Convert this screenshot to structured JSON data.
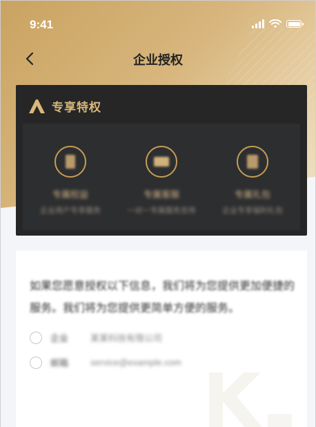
{
  "status_bar": {
    "time": "9:41"
  },
  "nav": {
    "title": "企业授权"
  },
  "privileges": {
    "title": "专享特权",
    "items": [
      {
        "label": "专属权益",
        "sub": "企业用户专享服务"
      },
      {
        "label": "专属客服",
        "sub": "一对一专属服务支持"
      },
      {
        "label": "专属礼包",
        "sub": "企业专享福利礼包"
      }
    ]
  },
  "authorization": {
    "intro": "如果您愿意授权以下信息，我们将为您提供更加便捷的服务。我们将为您提供更简单方便的服务。",
    "options": [
      {
        "label": "企业",
        "value": "某某科技有限公司"
      },
      {
        "label": "邮箱",
        "value": "service@example.com"
      }
    ]
  },
  "colors": {
    "gold": "#c9a361",
    "dark_card": "#262627",
    "accent_text": "#d9b877"
  }
}
